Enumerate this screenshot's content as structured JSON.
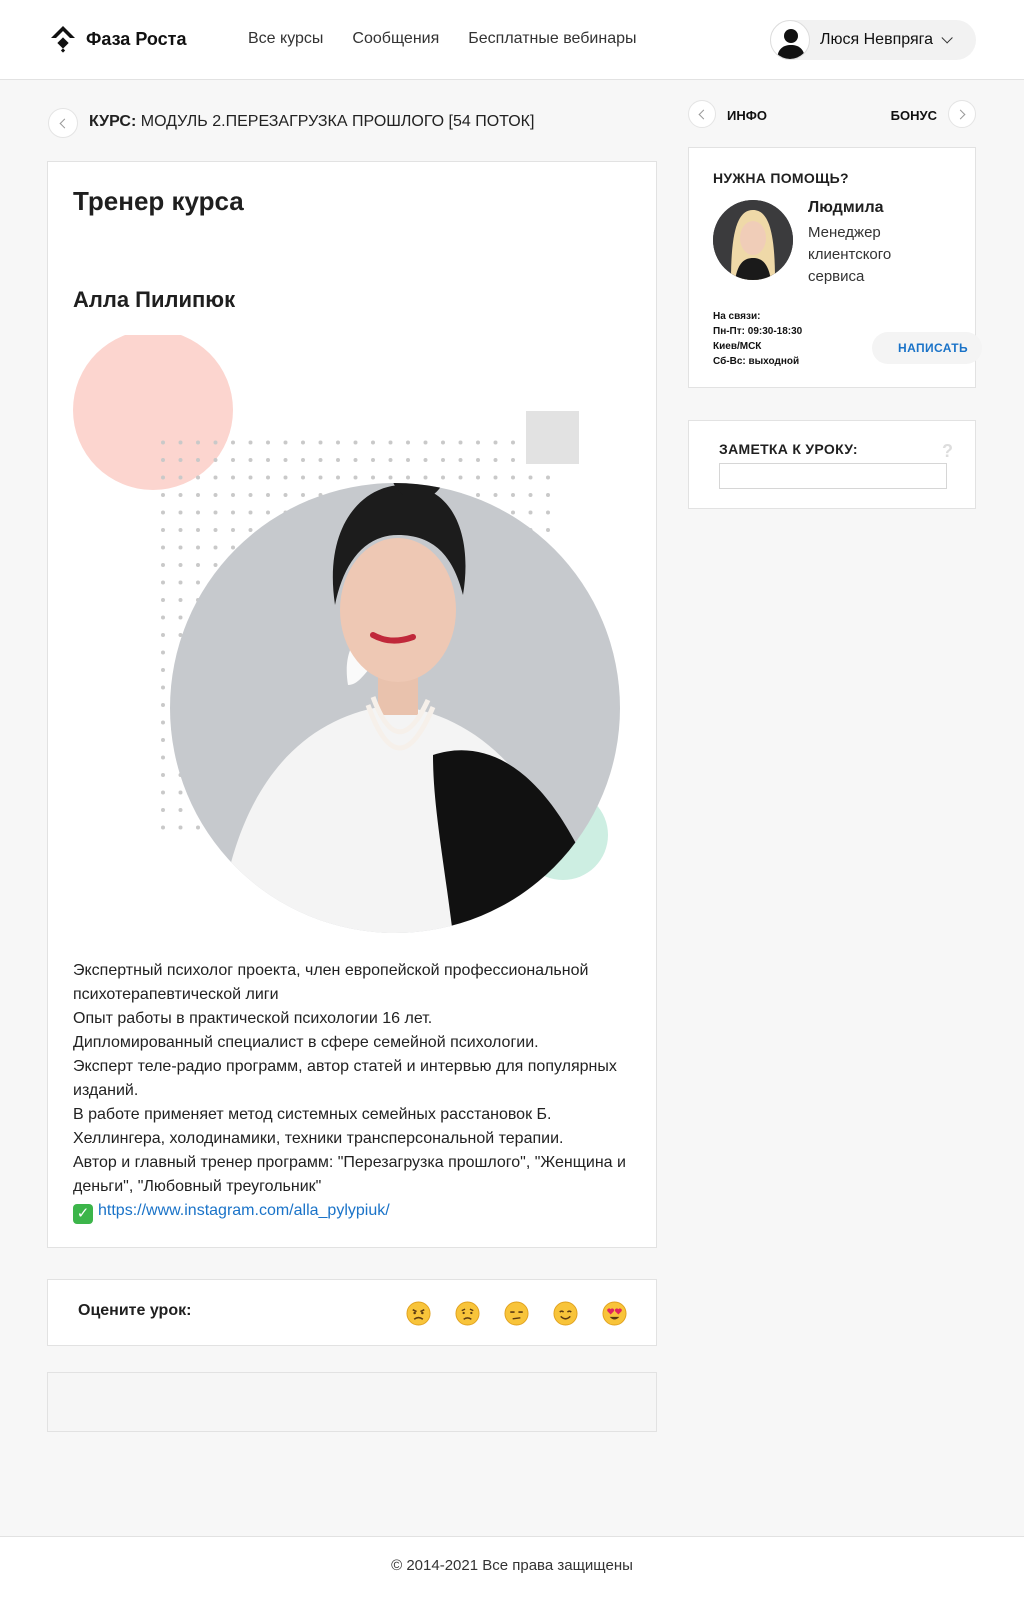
{
  "header": {
    "logo_text": "Фаза Роста",
    "nav": [
      "Все курсы",
      "Сообщения",
      "Бесплатные вебинары"
    ],
    "user_name": "Люся Невпряга"
  },
  "breadcrumb": {
    "prefix": "КУРС:",
    "title": "МОДУЛЬ 2.ПЕРЕЗАГРУЗКА ПРОШЛОГО [54 ПОТОК]"
  },
  "main": {
    "heading": "Тренер курса",
    "trainer_name": "Алла Пилипюк",
    "bio": [
      "Экспертный психолог проекта, член европейской профессиональной психотерапевтической лиги",
      "Опыт работы в практической психологии 16 лет.",
      "Дипломированный специалист в сфере семейной психологии.",
      "Эксперт теле-радио программ, автор статей и интервью для популярных изданий.",
      "В работе применяет метод системных семейных расстановок Б. Хеллингера, холодинамики, техники трансперсональной терапии.",
      "Автор и главный тренер программ: \"Перезагрузка прошлого\", \"Женщина и деньги\", \"Любовный треугольник\""
    ],
    "check_icon": "✓",
    "instagram_link": "https://www.instagram.com/alla_pylypiuk/"
  },
  "rating": {
    "label": "Оцените урок:",
    "emojis": [
      "angry-face",
      "sad-face",
      "unamused-face",
      "smiling-face",
      "heart-eyes-face"
    ]
  },
  "sidebar": {
    "tab_info": "ИНФО",
    "tab_bonus": "БОНУС",
    "help": {
      "title": "НУЖНА ПОМОЩЬ?",
      "manager_name": "Людмила",
      "manager_role": "Менеджер клиентского сервиса",
      "hours_title": "На связи:",
      "hours_weekdays": "Пн-Пт: 09:30-18:30",
      "hours_tz": "Киев/МСК",
      "hours_weekend": "Сб-Вс: выходной",
      "write_button": "НАПИСАТЬ"
    },
    "note": {
      "title": "ЗАМЕТКА К УРОКУ:",
      "help_mark": "?",
      "value": ""
    }
  },
  "footer": {
    "copyright": "© 2014-2021 Все права защищены"
  },
  "colors": {
    "accent_link": "#1a73c8",
    "peach_circle": "#fcd5cf",
    "mint_circle": "#cdeee2",
    "photo_bg": "#c6c9cd"
  }
}
